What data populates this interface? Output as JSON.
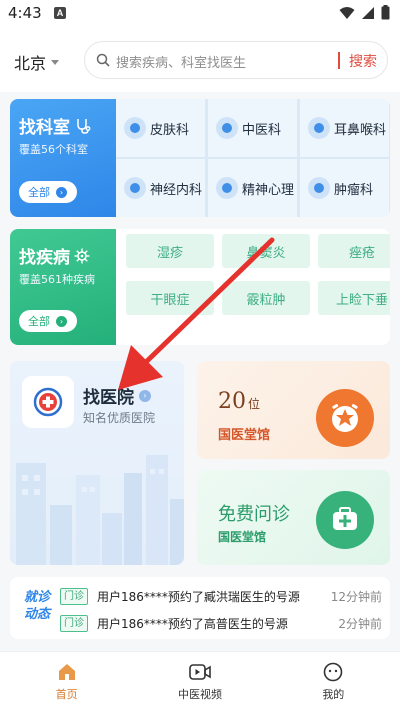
{
  "status_bar": {
    "time": "4:43",
    "notification_badge": "A"
  },
  "header": {
    "city": "北京",
    "search_placeholder": "搜索疾病、科室找医生",
    "search_button": "搜索"
  },
  "departments": {
    "title": "找科室",
    "subtitle": "覆盖56个科室",
    "all_label": "全部",
    "items": [
      {
        "label": "皮肤科"
      },
      {
        "label": "中医科"
      },
      {
        "label": "耳鼻喉科"
      },
      {
        "label": "神经内科"
      },
      {
        "label": "精神心理"
      },
      {
        "label": "肿瘤科"
      }
    ]
  },
  "diseases": {
    "title": "找疾病",
    "subtitle": "覆盖561种疾病",
    "all_label": "全部",
    "items": [
      "湿疹",
      "鼻窦炎",
      "痤疮",
      "干眼症",
      "霰粒肿",
      "上睑下垂"
    ]
  },
  "hospital": {
    "title": "找医院",
    "subtitle": "知名优质医院"
  },
  "clinics": {
    "count": "20",
    "unit": "位",
    "label": "国医堂馆"
  },
  "consult": {
    "title": "免费问诊",
    "label": "国医堂馆"
  },
  "ticker": {
    "brand_line1": "就诊",
    "brand_line2": "动态",
    "rows": [
      {
        "tag": "门诊",
        "message": "用户186****预约了臧洪瑞医生的号源",
        "ago": "12分钟前"
      },
      {
        "tag": "门诊",
        "message": "用户186****预约了高普医生的号源",
        "ago": "2分钟前"
      }
    ]
  },
  "bottom_nav": {
    "tabs": [
      {
        "label": "首页"
      },
      {
        "label": "中医视频"
      },
      {
        "label": "我的"
      }
    ]
  },
  "colors": {
    "accent_red": "#e04b3c",
    "dept_blue": "#2f86e8",
    "disease_green": "#24b07a",
    "clinic_orange": "#f0772f",
    "nav_active": "#d97a2a",
    "arrow_red": "#e5322d"
  }
}
